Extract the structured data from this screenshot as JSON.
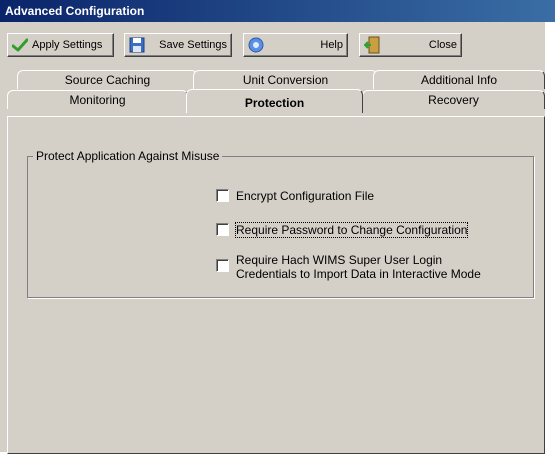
{
  "window": {
    "title": "Advanced Configuration"
  },
  "toolbar": {
    "buttons": [
      {
        "label": "Apply Settings",
        "icon": "checkmark-icon"
      },
      {
        "label": "Save Settings",
        "icon": "floppy-disk-icon"
      },
      {
        "label": "Help",
        "icon": "help-icon"
      },
      {
        "label": "Close",
        "icon": "exit-door-icon"
      }
    ]
  },
  "tabs": {
    "back_row": [
      "Source Caching",
      "Unit Conversion",
      "Additional Info"
    ],
    "front_row": [
      "Monitoring",
      "Protection",
      "Recovery"
    ],
    "active": "Protection"
  },
  "protection": {
    "group_title": "Protect Application Against Misuse",
    "options": [
      {
        "label": "Encrypt Configuration File",
        "checked": false
      },
      {
        "label": "Require Password to Change Configuration",
        "checked": false
      },
      {
        "label_line1": "Require Hach WIMS Super User Login",
        "label_line2": "Credentials to Import Data in Interactive Mode",
        "checked": false
      }
    ]
  },
  "colors": {
    "titlebar": "#0a246a",
    "face": "#d4d0c8",
    "check_green": "#2e9e2e",
    "save_blue": "#3a6fc4"
  }
}
